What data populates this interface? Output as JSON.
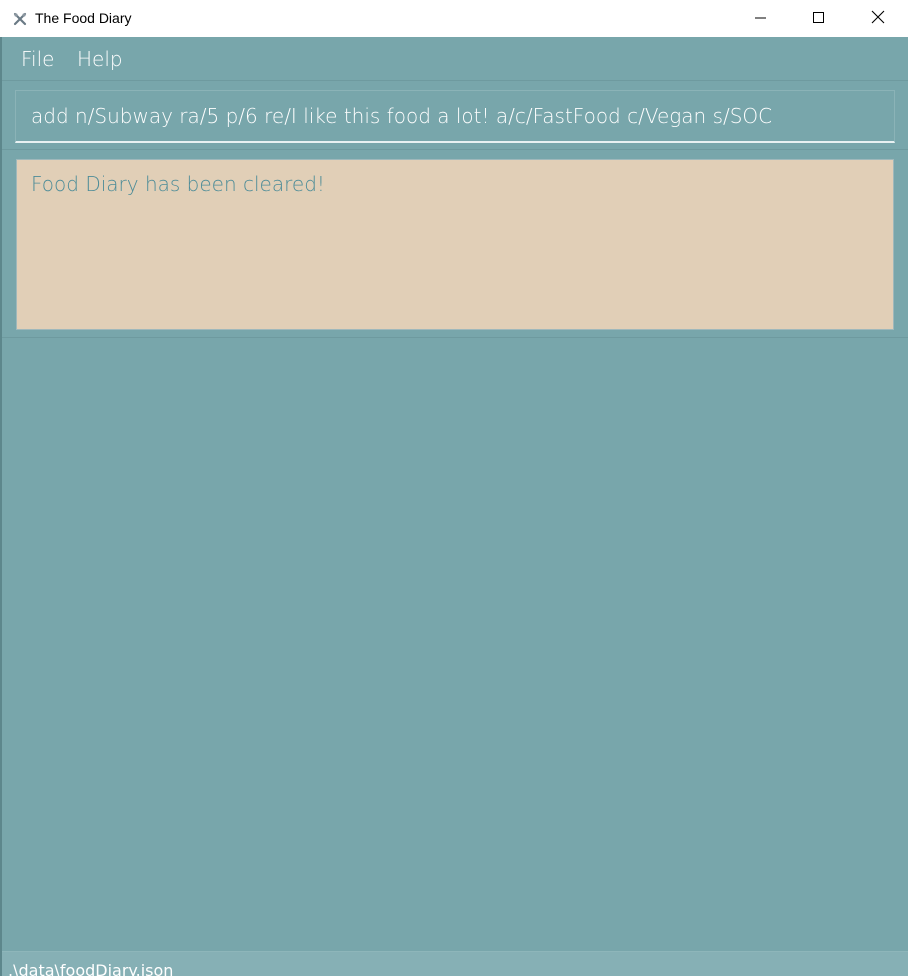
{
  "window": {
    "title": "The Food Diary",
    "icons": {
      "app": "app-icon",
      "minimize": "minimize-icon",
      "maximize": "maximize-icon",
      "close": "close-icon"
    }
  },
  "menu": {
    "file_label": "File",
    "help_label": "Help"
  },
  "command_box": {
    "value": "add n/Subway ra/5 p/6 re/I like this food a lot! a/c/FastFood c/Vegan s/SOC"
  },
  "result_display": {
    "message": "Food Diary has been cleared!"
  },
  "status_bar": {
    "path": ".\\data\\foodDiary.json"
  },
  "colors": {
    "background": "#78a6ab",
    "result_background": "#e1cfb7",
    "result_text": "#4d8c98"
  }
}
